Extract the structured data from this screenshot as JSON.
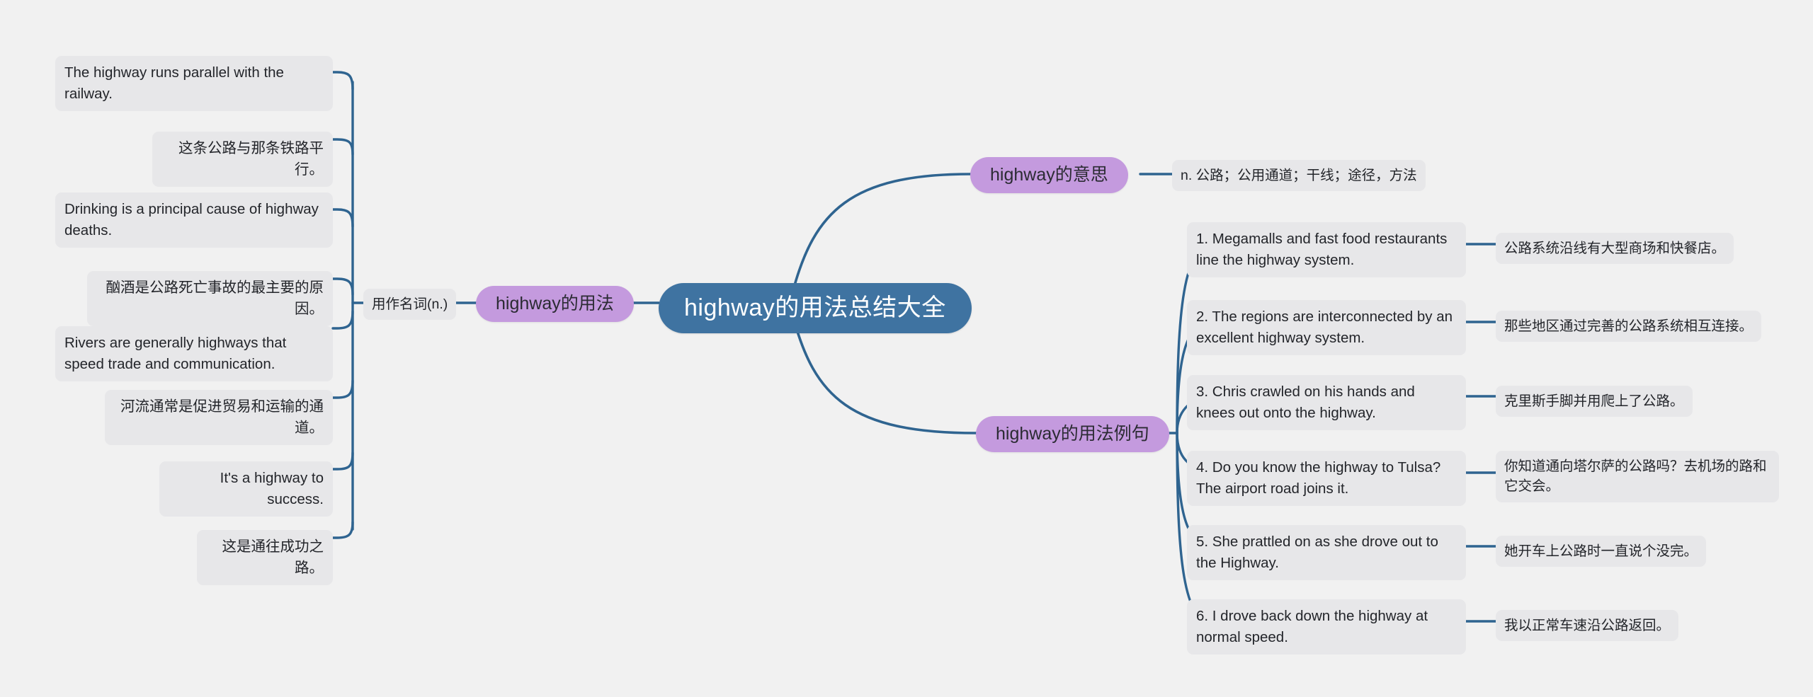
{
  "colors": {
    "background": "#f1f1f1",
    "root_fill": "#3f73a1",
    "root_text": "#ffffff",
    "branch_fill": "#c49ade",
    "branch_text": "#2b2b33",
    "leaf_fill": "#e7e7e9",
    "leaf_text": "#23252a",
    "edge_stroke": "#2f6490"
  },
  "root": {
    "label": "highway的用法总结大全"
  },
  "branches": {
    "usage": {
      "label": "highway的用法",
      "child_label": "用作名词(n.)"
    },
    "meaning": {
      "label": "highway的意思",
      "definition": "n. 公路；公用通道；干线；途径，方法"
    },
    "examples": {
      "label": "highway的用法例句"
    }
  },
  "noun_examples": [
    {
      "en": "The highway runs parallel with the railway.",
      "cn": "这条公路与那条铁路平行。"
    },
    {
      "en": "Drinking is a principal cause of highway deaths.",
      "cn": "酗酒是公路死亡事故的最主要的原因。"
    },
    {
      "en": "Rivers are generally highways that speed trade and communication.",
      "cn": "河流通常是促进贸易和运输的通道。"
    },
    {
      "en": "It's a highway to success.",
      "cn": "这是通往成功之路。"
    }
  ],
  "sentence_examples": [
    {
      "en": "1. Megamalls and fast food restaurants line the highway system.",
      "cn": "公路系统沿线有大型商场和快餐店。"
    },
    {
      "en": "2. The regions are interconnected by an excellent highway system.",
      "cn": "那些地区通过完善的公路系统相互连接。"
    },
    {
      "en": "3. Chris crawled on his hands and knees out onto the highway.",
      "cn": "克里斯手脚并用爬上了公路。"
    },
    {
      "en": "4. Do you know the highway to Tulsa? The airport road joins it.",
      "cn": "你知道通向塔尔萨的公路吗？去机场的路和它交会。"
    },
    {
      "en": "5. She prattled on as she drove out to the Highway.",
      "cn": "她开车上公路时一直说个没完。"
    },
    {
      "en": "6. I drove back down the highway at normal speed.",
      "cn": "我以正常车速沿公路返回。"
    }
  ]
}
